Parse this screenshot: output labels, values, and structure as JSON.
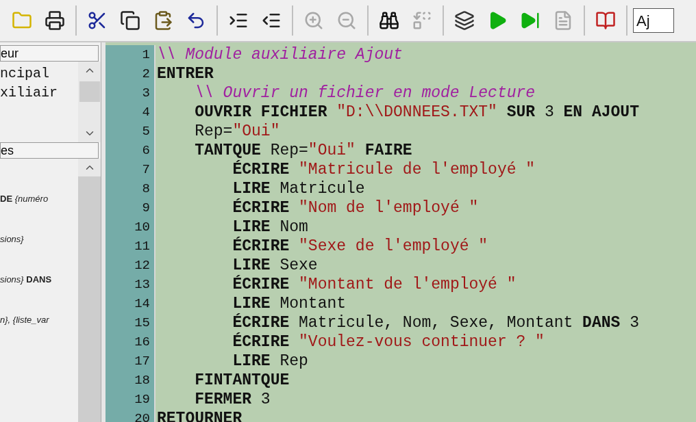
{
  "toolbar": {
    "buttons": [
      {
        "disabled": false
      },
      {
        "disabled": false
      },
      {
        "disabled": false
      },
      {
        "disabled": false
      },
      {
        "disabled": false
      },
      {
        "disabled": false
      },
      {
        "disabled": false
      },
      {
        "disabled": false
      },
      {
        "disabled": true
      },
      {
        "disabled": true
      },
      {
        "disabled": false
      },
      {
        "disabled": true
      },
      {
        "disabled": false
      },
      {
        "disabled": false
      },
      {
        "disabled": false
      },
      {
        "disabled": true
      },
      {
        "disabled": false
      }
    ],
    "combo": {
      "value": "Aj"
    }
  },
  "left_panel": {
    "top_header": "eur",
    "top_items": [
      "ncipal",
      "xiliair"
    ],
    "bottom_header": "es",
    "bottom_items": [
      "**DE** *{numéro*",
      "*sions}*",
      "*sions}* **DANS**",
      "*n}, {liste_var*"
    ]
  },
  "editor": {
    "lines": [
      {
        "number": "1",
        "tokens": [
          {
            "kind": "comment",
            "text": "\\\\ Module auxiliaire Ajout"
          }
        ]
      },
      {
        "number": "2",
        "tokens": [
          {
            "kind": "keyword",
            "text": "ENTRER"
          }
        ]
      },
      {
        "number": "3",
        "tokens": [
          {
            "kind": "comment",
            "text": "    \\\\ Ouvrir un fichier en mode Lecture"
          }
        ]
      },
      {
        "number": "4",
        "tokens": [
          {
            "kind": "keyword",
            "text": "    OUVRIR FICHIER "
          },
          {
            "kind": "string",
            "text": "\"D:\\\\DONNEES.TXT\""
          },
          {
            "kind": "keyword",
            "text": " SUR "
          },
          {
            "kind": "plain",
            "text": "3"
          },
          {
            "kind": "keyword",
            "text": " EN AJOUT"
          }
        ]
      },
      {
        "number": "5",
        "tokens": [
          {
            "kind": "plain",
            "text": "    Rep="
          },
          {
            "kind": "string",
            "text": "\"Oui\""
          }
        ]
      },
      {
        "number": "6",
        "tokens": [
          {
            "kind": "keyword",
            "text": "    TANTQUE"
          },
          {
            "kind": "plain",
            "text": " Rep="
          },
          {
            "kind": "string",
            "text": "\"Oui\""
          },
          {
            "kind": "keyword",
            "text": " FAIRE"
          }
        ]
      },
      {
        "number": "7",
        "tokens": [
          {
            "kind": "keyword",
            "text": "        ÉCRIRE "
          },
          {
            "kind": "string",
            "text": "\"Matricule de l'employé \""
          }
        ]
      },
      {
        "number": "8",
        "tokens": [
          {
            "kind": "keyword",
            "text": "        LIRE"
          },
          {
            "kind": "plain",
            "text": " Matricule"
          }
        ]
      },
      {
        "number": "9",
        "tokens": [
          {
            "kind": "keyword",
            "text": "        ÉCRIRE "
          },
          {
            "kind": "string",
            "text": "\"Nom de l'employé \""
          }
        ]
      },
      {
        "number": "10",
        "tokens": [
          {
            "kind": "keyword",
            "text": "        LIRE"
          },
          {
            "kind": "plain",
            "text": " Nom"
          }
        ]
      },
      {
        "number": "11",
        "tokens": [
          {
            "kind": "keyword",
            "text": "        ÉCRIRE "
          },
          {
            "kind": "string",
            "text": "\"Sexe de l'employé \""
          }
        ]
      },
      {
        "number": "12",
        "tokens": [
          {
            "kind": "keyword",
            "text": "        LIRE"
          },
          {
            "kind": "plain",
            "text": " Sexe"
          }
        ]
      },
      {
        "number": "13",
        "tokens": [
          {
            "kind": "keyword",
            "text": "        ÉCRIRE "
          },
          {
            "kind": "string",
            "text": "\"Montant de l'employé \""
          }
        ]
      },
      {
        "number": "14",
        "tokens": [
          {
            "kind": "keyword",
            "text": "        LIRE"
          },
          {
            "kind": "plain",
            "text": " Montant"
          }
        ]
      },
      {
        "number": "15",
        "tokens": [
          {
            "kind": "keyword",
            "text": "        ÉCRIRE"
          },
          {
            "kind": "plain",
            "text": " Matricule, Nom, Sexe, Montant "
          },
          {
            "kind": "keyword",
            "text": "DANS"
          },
          {
            "kind": "plain",
            "text": " 3"
          }
        ]
      },
      {
        "number": "16",
        "tokens": [
          {
            "kind": "keyword",
            "text": "        ÉCRIRE "
          },
          {
            "kind": "string",
            "text": "\"Voulez-vous continuer ? \""
          }
        ]
      },
      {
        "number": "17",
        "tokens": [
          {
            "kind": "keyword",
            "text": "        LIRE"
          },
          {
            "kind": "plain",
            "text": " Rep"
          }
        ]
      },
      {
        "number": "18",
        "tokens": [
          {
            "kind": "keyword",
            "text": "    FINTANTQUE"
          }
        ]
      },
      {
        "number": "19",
        "tokens": [
          {
            "kind": "keyword",
            "text": "    FERMER"
          },
          {
            "kind": "plain",
            "text": " 3"
          }
        ]
      },
      {
        "number": "20",
        "tokens": [
          {
            "kind": "keyword",
            "text": "RETOURNER"
          }
        ]
      }
    ]
  }
}
